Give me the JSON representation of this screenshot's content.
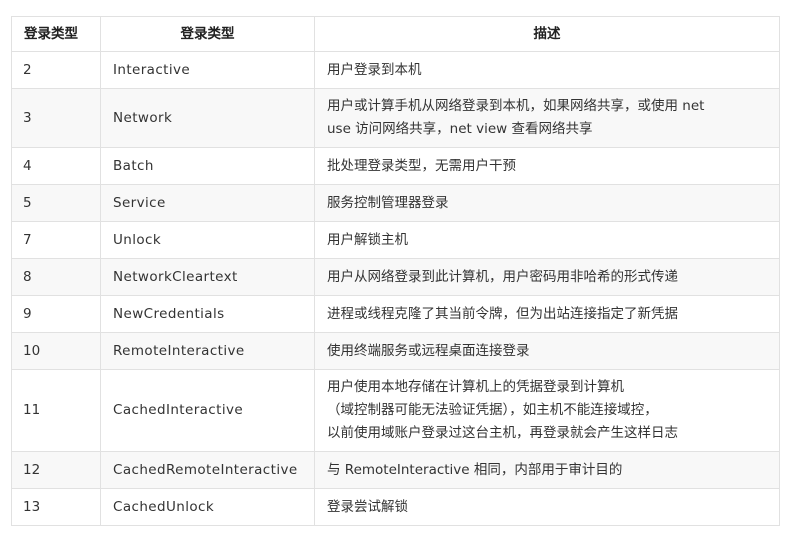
{
  "table": {
    "headers": [
      "登录类型",
      "登录类型",
      "描述"
    ],
    "rows": [
      {
        "id": "2",
        "name": "Interactive",
        "desc": [
          "用户登录到本机"
        ]
      },
      {
        "id": "3",
        "name": "Network",
        "desc": [
          "用户或计算手机从网络登录到本机，如果网络共享，或使用 net",
          "use 访问网络共享，net view 查看网络共享"
        ]
      },
      {
        "id": "4",
        "name": "Batch",
        "desc": [
          "批处理登录类型，无需用户干预"
        ]
      },
      {
        "id": "5",
        "name": "Service",
        "desc": [
          "服务控制管理器登录"
        ]
      },
      {
        "id": "7",
        "name": "Unlock",
        "desc": [
          "用户解锁主机"
        ]
      },
      {
        "id": "8",
        "name": "NetworkCleartext",
        "desc": [
          "用户从网络登录到此计算机，用户密码用非哈希的形式传递"
        ]
      },
      {
        "id": "9",
        "name": "NewCredentials",
        "desc": [
          "进程或线程克隆了其当前令牌，但为出站连接指定了新凭据"
        ]
      },
      {
        "id": "10",
        "name": "RemoteInteractive",
        "desc": [
          "使用终端服务或远程桌面连接登录"
        ]
      },
      {
        "id": "11",
        "name": "CachedInteractive",
        "desc": [
          "用户使用本地存储在计算机上的凭据登录到计算机",
          "（域控制器可能无法验证凭据），如主机不能连接域控，",
          "以前使用域账户登录过这台主机，再登录就会产生这样日志"
        ]
      },
      {
        "id": "12",
        "name": "CachedRemoteInteractive",
        "desc": [
          "与 RemoteInteractive 相同，内部用于审计目的"
        ]
      },
      {
        "id": "13",
        "name": "CachedUnlock",
        "desc": [
          "登录尝试解锁"
        ]
      }
    ]
  }
}
